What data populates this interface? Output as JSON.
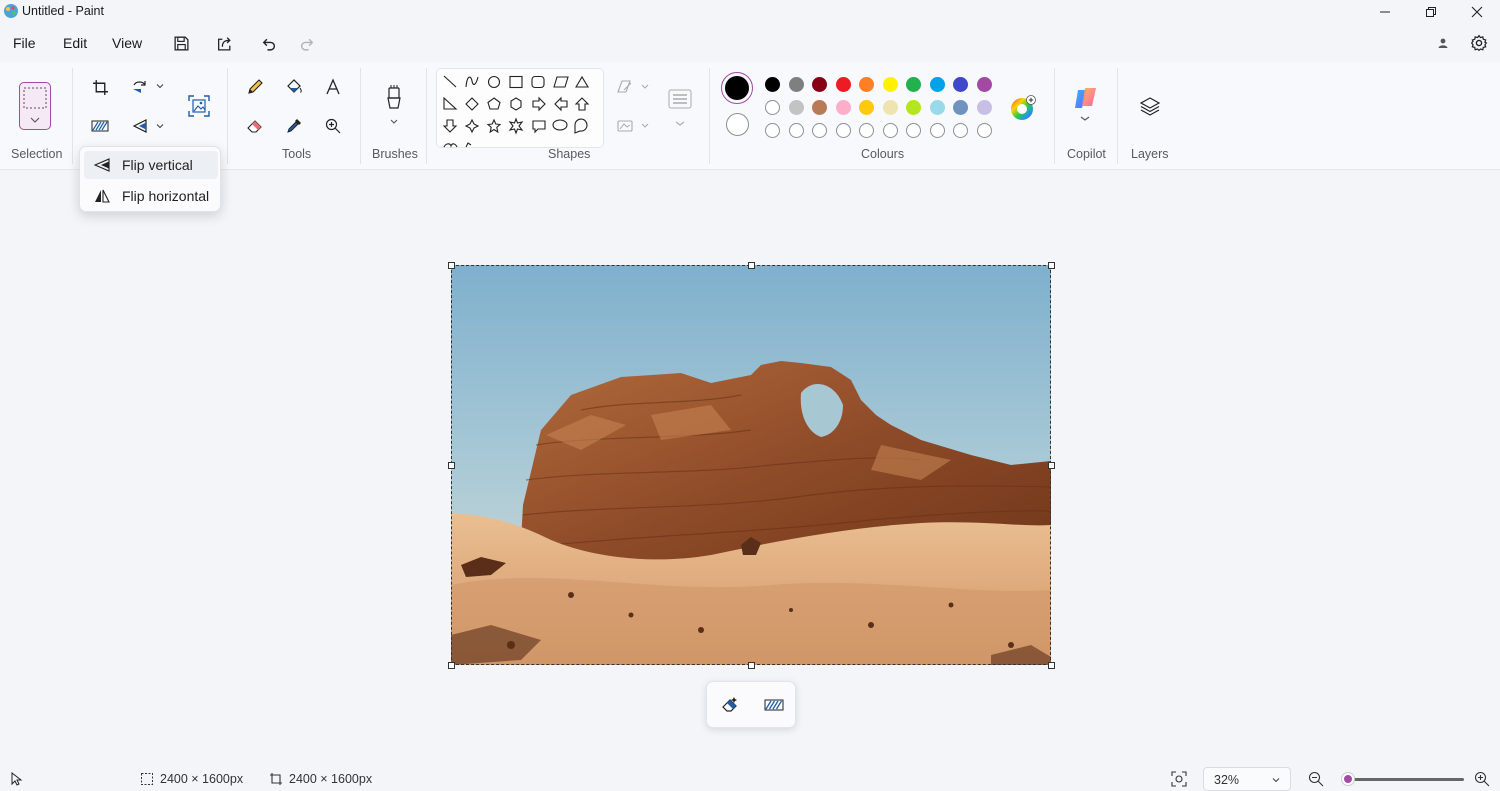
{
  "window": {
    "title": "Untitled - Paint"
  },
  "menu": {
    "file": "File",
    "edit": "Edit",
    "view": "View"
  },
  "ribbon": {
    "groups": {
      "selection": "Selection",
      "tools": "Tools",
      "brushes": "Brushes",
      "shapes": "Shapes",
      "colours": "Colours",
      "copilot": "Copilot",
      "layers": "Layers"
    }
  },
  "flip_menu": {
    "items": [
      {
        "label": "Flip vertical",
        "icon": "flip-vertical-icon"
      },
      {
        "label": "Flip horizontal",
        "icon": "flip-horizontal-icon"
      }
    ]
  },
  "colours": {
    "primary": "#000000",
    "secondary": "#ffffff",
    "row1": [
      "#000000",
      "#7f7f7f",
      "#880015",
      "#ed1c24",
      "#ff7f27",
      "#fff200",
      "#22b14c",
      "#00a2e8",
      "#3f48cc",
      "#a349a4"
    ],
    "row2": [
      "#ffffff",
      "#c3c3c3",
      "#b97a57",
      "#ffaec9",
      "#ffc90e",
      "#efe4b0",
      "#b5e61d",
      "#99d9ea",
      "#7092be",
      "#c8bfe7"
    ],
    "row3_count": 10,
    "accent": "#a44aa4"
  },
  "status": {
    "selection_size": "2400 × 1600px",
    "canvas_size": "2400 × 1600px",
    "zoom": "32%",
    "zoom_fraction": 0.05
  }
}
